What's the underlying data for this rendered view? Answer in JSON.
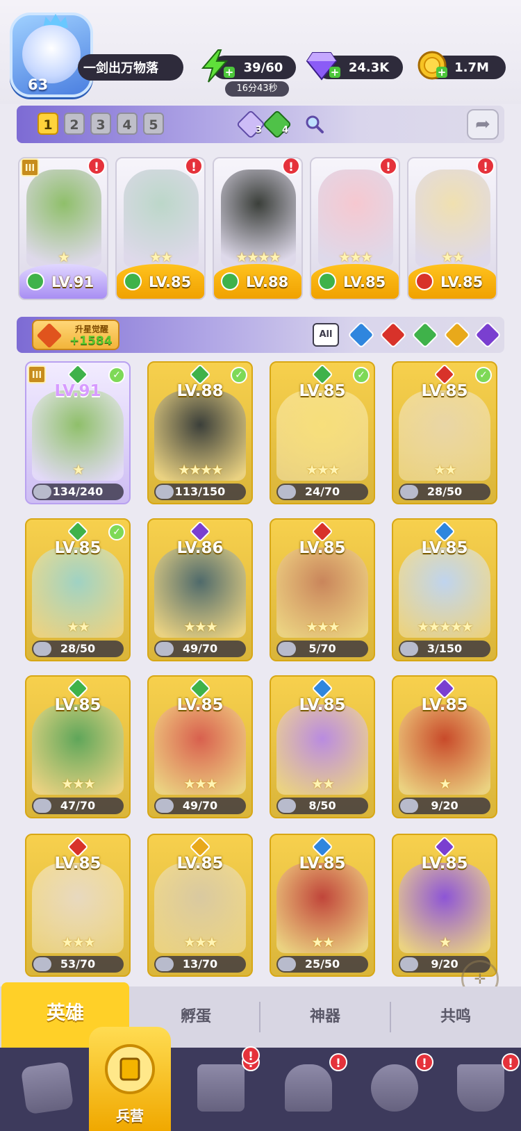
{
  "player": {
    "level": "63",
    "name": "一剑出万物落"
  },
  "resources": {
    "energy": {
      "value": "39/60",
      "timer": "16分43秒",
      "icon": "lightning-icon"
    },
    "gems": {
      "value": "24.3K",
      "icon": "diamond-icon"
    },
    "gold": {
      "value": "1.7M",
      "icon": "coin-icon"
    }
  },
  "team": {
    "tabs": [
      "1",
      "2",
      "3",
      "4",
      "5"
    ],
    "active_tab": "1",
    "gem_counts": [
      "3",
      "4"
    ],
    "slots": [
      {
        "level": "LV.91",
        "element": "wind",
        "stars": "★",
        "rank": "III",
        "alert": "!"
      },
      {
        "level": "LV.85",
        "element": "wind",
        "stars": "★★",
        "alert": "!"
      },
      {
        "level": "LV.88",
        "element": "wind",
        "stars": "★★★★",
        "alert": "!"
      },
      {
        "level": "LV.85",
        "element": "wind",
        "stars": "★★★",
        "alert": "!"
      },
      {
        "level": "LV.85",
        "element": "fire",
        "stars": "★★",
        "alert": "!"
      }
    ]
  },
  "filter": {
    "upgrade_title": "升星觉醒",
    "upgrade_value": "+1584",
    "all_label": "All",
    "elements": [
      "water",
      "fire",
      "wind",
      "light",
      "dark"
    ]
  },
  "element_colors": {
    "wind": "#3fb24a",
    "fire": "#d8322a",
    "water": "#2f86de",
    "light": "#e8a91b",
    "dark": "#7a3fd0"
  },
  "heroes": [
    {
      "level": "LV.91",
      "element": "wind",
      "shards": "134/240",
      "stars": "★",
      "checked": "✓",
      "rank": "III",
      "style": "purple",
      "art": "#8fbf6a"
    },
    {
      "level": "LV.88",
      "element": "wind",
      "shards": "113/150",
      "stars": "★★★★",
      "checked": "✓",
      "art": "#3b3f3a"
    },
    {
      "level": "LV.85",
      "element": "wind",
      "shards": "24/70",
      "stars": "★★★",
      "checked": "✓",
      "art": "#f7df7b"
    },
    {
      "level": "LV.85",
      "element": "fire",
      "shards": "28/50",
      "stars": "★★",
      "checked": "✓",
      "art": "#e9d6a6"
    },
    {
      "level": "LV.85",
      "element": "wind",
      "shards": "28/50",
      "stars": "★★",
      "checked": "✓",
      "art": "#9fd2c3"
    },
    {
      "level": "LV.86",
      "element": "dark",
      "shards": "49/70",
      "stars": "★★★",
      "art": "#4f6a6b"
    },
    {
      "level": "LV.85",
      "element": "fire",
      "shards": "5/70",
      "stars": "★★★",
      "art": "#c9855b"
    },
    {
      "level": "LV.85",
      "element": "water",
      "shards": "3/150",
      "stars": "★★★★★",
      "art": "#bfd4ee"
    },
    {
      "level": "LV.85",
      "element": "wind",
      "shards": "47/70",
      "stars": "★★★",
      "art": "#5fa65a"
    },
    {
      "level": "LV.85",
      "element": "wind",
      "shards": "49/70",
      "stars": "★★★",
      "art": "#d8604e"
    },
    {
      "level": "LV.85",
      "element": "water",
      "shards": "8/50",
      "stars": "★★",
      "art": "#b98be0"
    },
    {
      "level": "LV.85",
      "element": "dark",
      "shards": "9/20",
      "stars": "★",
      "art": "#c84a2a"
    },
    {
      "level": "LV.85",
      "element": "fire",
      "shards": "53/70",
      "stars": "★★★",
      "art": "#e8d9bf"
    },
    {
      "level": "LV.85",
      "element": "light",
      "shards": "13/70",
      "stars": "★★★",
      "art": "#d9c9a0"
    },
    {
      "level": "LV.85",
      "element": "water",
      "shards": "25/50",
      "stars": "★★",
      "art": "#c0453a"
    },
    {
      "level": "LV.85",
      "element": "dark",
      "shards": "9/20",
      "stars": "★",
      "art": "#8d55d6"
    }
  ],
  "subtabs": [
    "英雄",
    "孵蛋",
    "神器",
    "共鸣"
  ],
  "nav": {
    "active_label": "兵营"
  }
}
